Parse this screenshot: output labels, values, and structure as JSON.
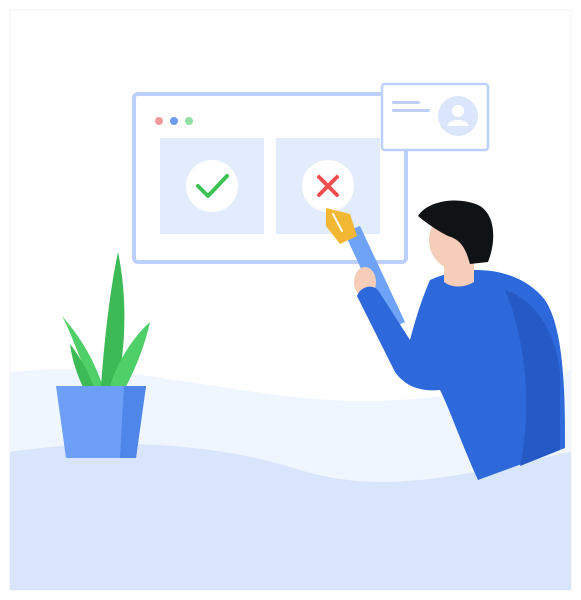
{
  "illustration": {
    "subject": "",
    "palette": {
      "background": "#ffffff",
      "wave_light": "#f0f6ff",
      "wave_main": "#d8e5fd",
      "browser_border": "#bcd0fb",
      "panel_fill": "#e2ecfc",
      "check_color": "#3ec254",
      "cross_color": "#f04f4f",
      "dot_red": "#f3999a",
      "dot_blue": "#6f9cf1",
      "dot_green": "#91dfa1",
      "person_shirt": "#2e69dc",
      "person_shirt_shadow": "#2559c5",
      "skin": "#f6cdb8",
      "hair": "#101316",
      "pen_body": "#6fa3f7",
      "pen_tip": "#f2b733",
      "plant_leaf": "#3cba55",
      "plant_leaf_light": "#4fcf67",
      "pot": "#6d9ff6",
      "pot_shadow": "#4f86e9"
    },
    "icons": {
      "approve": "check-icon",
      "reject": "cross-icon",
      "profile": "avatar-icon"
    }
  }
}
